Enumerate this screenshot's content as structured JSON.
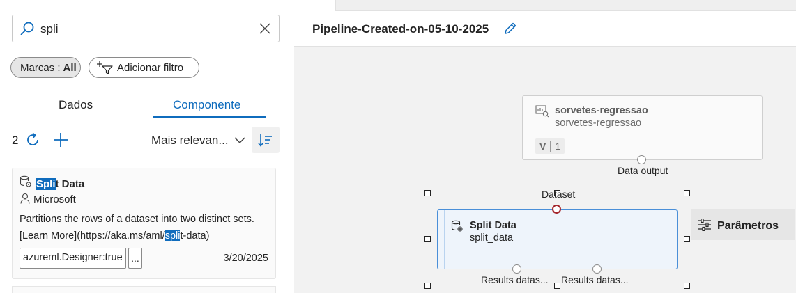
{
  "search": {
    "value": "spli"
  },
  "filters": {
    "tags_label": "Marcas :",
    "tags_value": "All",
    "add_filter_label": "Adicionar filtro"
  },
  "tabs": [
    {
      "label": "Dados"
    },
    {
      "label": "Componente"
    }
  ],
  "results": {
    "count": "2",
    "sort_label": "Mais relevan..."
  },
  "component_card": {
    "title_highlight": "Spli",
    "title_rest": "t Data",
    "author": "Microsoft",
    "description": "Partitions the rows of a dataset into two distinct sets.",
    "link_before": "[Learn More](https://aka.ms/aml/",
    "link_highlight": "spli",
    "link_after": "t-data)",
    "tag": "azureml.Designer:true",
    "more": "...",
    "date": "3/20/2025"
  },
  "pipeline": {
    "title": "Pipeline-Created-on-05-10-2025"
  },
  "dataset_node": {
    "title": "sorvetes-regressao",
    "subtitle": "sorvetes-regressao",
    "version_label": "V",
    "version_number": "1",
    "output_port_label": "Data output"
  },
  "split_node": {
    "title": "Split Data",
    "subtitle": "split_data",
    "input_port_label": "Dataset",
    "output_port_1_label": "Results datas...",
    "output_port_2_label": "Results datas..."
  },
  "params_button": {
    "label": "Parâmetros"
  },
  "colors": {
    "accent": "#0f6cbd",
    "highlight": "#0f6cbd",
    "selected_port": "#a4262c"
  }
}
